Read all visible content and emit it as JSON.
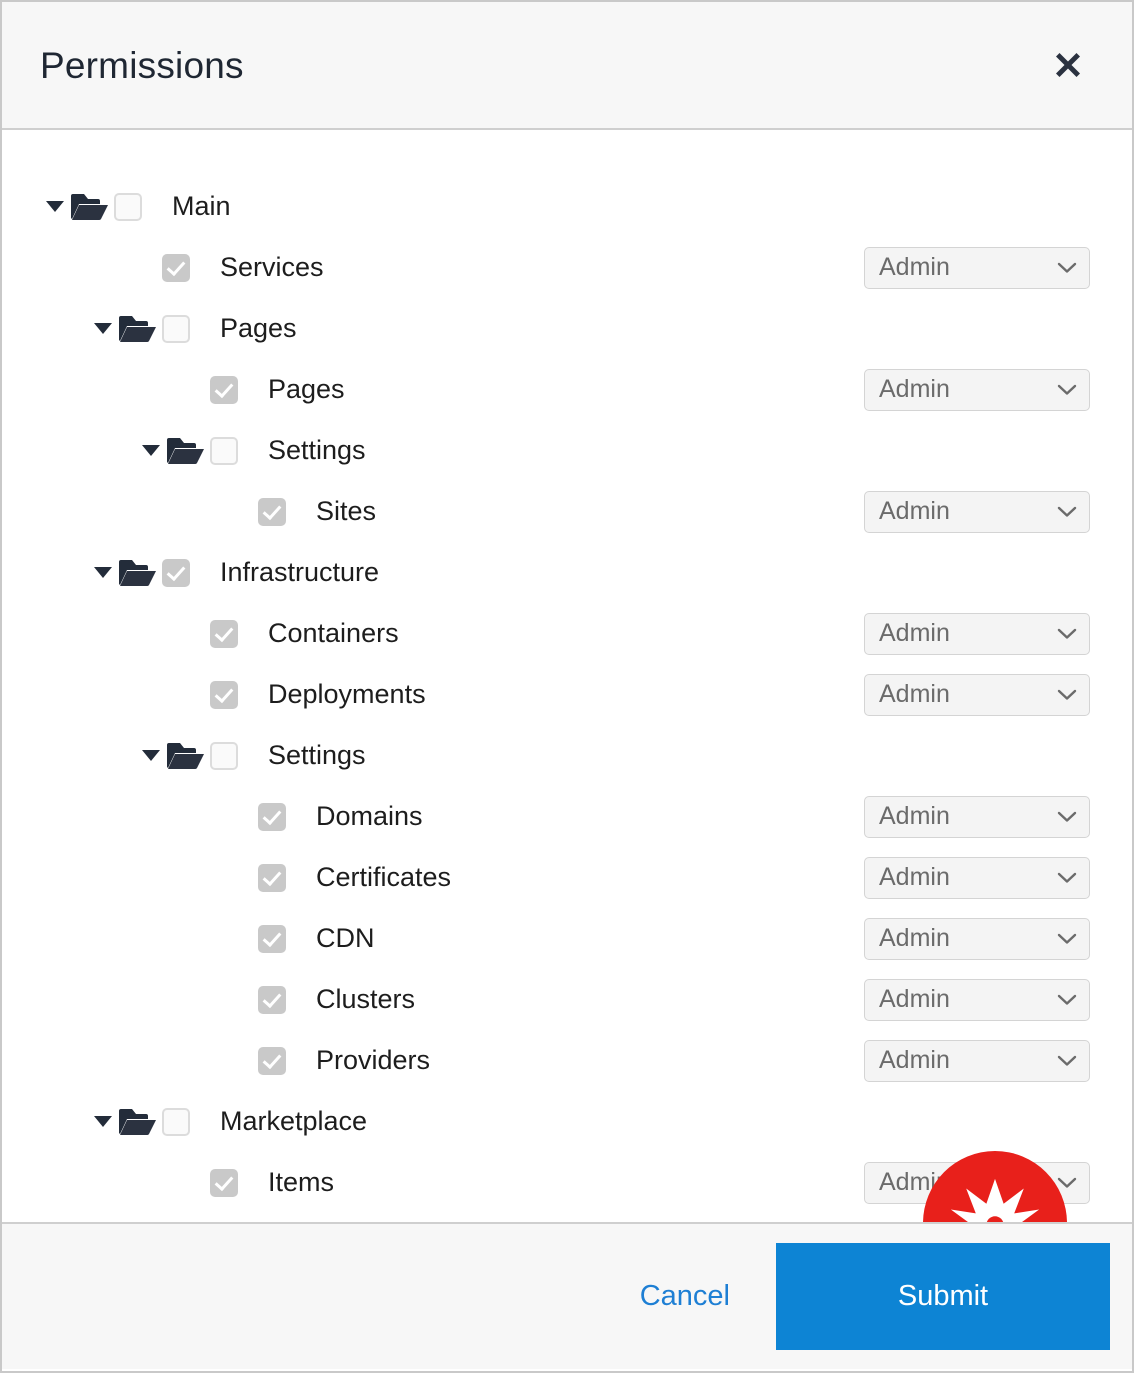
{
  "dialog": {
    "title": "Permissions",
    "close_icon": "close-icon"
  },
  "tree": {
    "nodes": [
      {
        "label": "Main",
        "level": 0,
        "type": "folder",
        "checked": false,
        "expanded": true,
        "role": null
      },
      {
        "label": "Services",
        "level": 1,
        "type": "leaf",
        "checked": true,
        "expanded": false,
        "role": "Admin"
      },
      {
        "label": "Pages",
        "level": 1,
        "type": "folder",
        "checked": false,
        "expanded": true,
        "role": null
      },
      {
        "label": "Pages",
        "level": 2,
        "type": "leaf",
        "checked": true,
        "expanded": false,
        "role": "Admin"
      },
      {
        "label": "Settings",
        "level": 2,
        "type": "folder",
        "checked": false,
        "expanded": true,
        "role": null
      },
      {
        "label": "Sites",
        "level": 3,
        "type": "leaf",
        "checked": true,
        "expanded": false,
        "role": "Admin"
      },
      {
        "label": "Infrastructure",
        "level": 1,
        "type": "folder",
        "checked": true,
        "expanded": true,
        "role": null
      },
      {
        "label": "Containers",
        "level": 2,
        "type": "leaf",
        "checked": true,
        "expanded": false,
        "role": "Admin"
      },
      {
        "label": "Deployments",
        "level": 2,
        "type": "leaf",
        "checked": true,
        "expanded": false,
        "role": "Admin"
      },
      {
        "label": "Settings",
        "level": 2,
        "type": "folder",
        "checked": false,
        "expanded": true,
        "role": null
      },
      {
        "label": "Domains",
        "level": 3,
        "type": "leaf",
        "checked": true,
        "expanded": false,
        "role": "Admin"
      },
      {
        "label": "Certificates",
        "level": 3,
        "type": "leaf",
        "checked": true,
        "expanded": false,
        "role": "Admin"
      },
      {
        "label": "CDN",
        "level": 3,
        "type": "leaf",
        "checked": true,
        "expanded": false,
        "role": "Admin"
      },
      {
        "label": "Clusters",
        "level": 3,
        "type": "leaf",
        "checked": true,
        "expanded": false,
        "role": "Admin"
      },
      {
        "label": "Providers",
        "level": 3,
        "type": "leaf",
        "checked": true,
        "expanded": false,
        "role": "Admin"
      },
      {
        "label": "Marketplace",
        "level": 1,
        "type": "folder",
        "checked": false,
        "expanded": true,
        "role": null
      },
      {
        "label": "Items",
        "level": 2,
        "type": "leaf",
        "checked": true,
        "expanded": false,
        "role": "Admin"
      }
    ]
  },
  "footer": {
    "cancel_label": "Cancel",
    "submit_label": "Submit"
  },
  "overlay": {
    "badge_icon": "starburst-icon",
    "badge_color": "#e8201b"
  },
  "colors": {
    "accent": "#0d84d4",
    "link": "#1e7fd4",
    "header_bg": "#f7f7f7",
    "checkbox_checked": "#c9c9c9",
    "select_bg": "#f4f4f4",
    "title_text": "#1f2733"
  }
}
